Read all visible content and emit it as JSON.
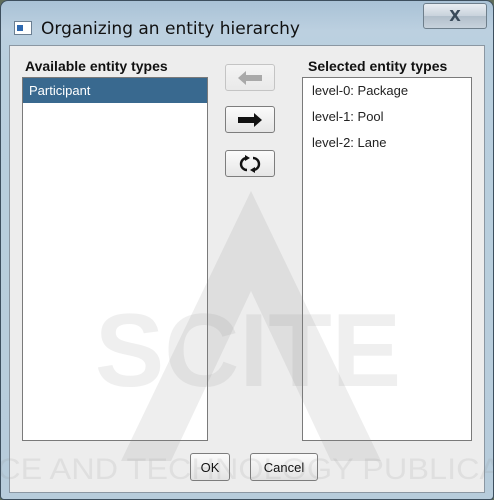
{
  "window": {
    "title": "Organizing an entity hierarchy",
    "close_label": "X"
  },
  "available": {
    "header": "Available entity types",
    "items": [
      "Participant"
    ],
    "selected_index": 0
  },
  "selected": {
    "header": "Selected entity types",
    "items": [
      "level-0: Package",
      "level-1: Pool",
      "level-2: Lane"
    ]
  },
  "controls": {
    "move_left_icon": "arrow-left-icon",
    "move_left_enabled": false,
    "move_right_icon": "arrow-right-icon",
    "move_right_enabled": true,
    "reset_icon": "refresh-icon"
  },
  "footer": {
    "ok_label": "OK",
    "cancel_label": "Cancel"
  },
  "watermark": {
    "logo_text": "SCITE",
    "tagline": "SCIENCE AND TECHNOLOGY PUBLICATIONS"
  },
  "colors": {
    "selection": "#39698f",
    "title_bar": "#b9cfde"
  }
}
